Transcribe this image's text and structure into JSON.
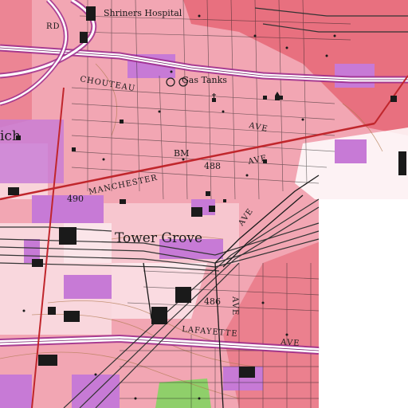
{
  "map": {
    "labels": {
      "shriners": "Shriners Hospital",
      "rd": "RD",
      "chouteau": "CHOUTEAU",
      "gas_tanks": "Gas Tanks",
      "ave_1": "AVE",
      "ave_2": "AVE",
      "bm": "BM",
      "bm_elev": "488",
      "manchester": "MANCHESTER",
      "elev_490": "490",
      "ave_3": "AVE",
      "tower_grove": "Tower Grove",
      "elev_486": "486",
      "ave_vert": "AVE",
      "lafayette": "LAFAYETTE",
      "ave_4": "AVE",
      "ich": "ich"
    },
    "colors": {
      "urban_tint": "#f2a6b3",
      "dense_urban": "#e8707f",
      "purple_revision": "#c77ad6",
      "building": "#1a1a1a",
      "road": "#9b2a8c",
      "highway_line": "#7a1f6e",
      "main_road": "#c0262c",
      "park_green": "#8fcf6a",
      "railroad": "#333333",
      "contour": "#b07a50",
      "white_area": "#ffffff"
    },
    "icons": [
      "building-icon",
      "gas-tank-icon",
      "church-icon",
      "school-icon"
    ]
  }
}
